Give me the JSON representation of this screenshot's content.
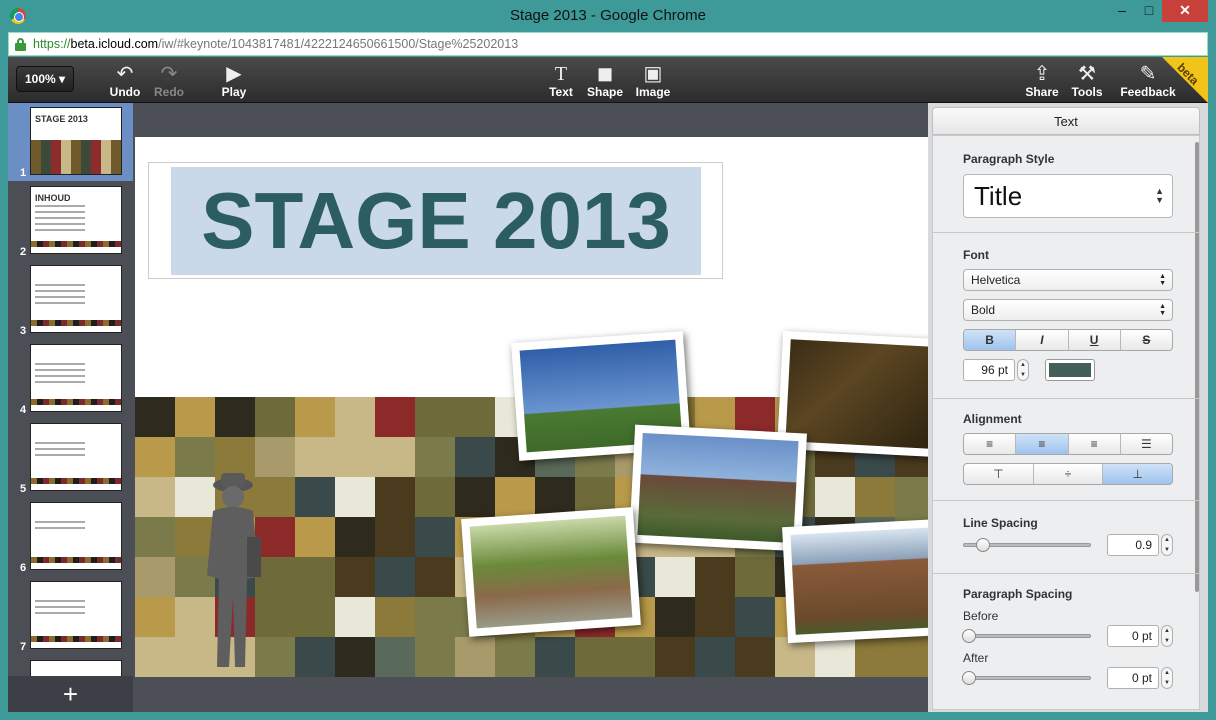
{
  "window": {
    "title": "Stage 2013 - Google Chrome",
    "minimize": "–",
    "maximize": "□",
    "close": "✕"
  },
  "address": {
    "scheme": "https://",
    "host": "beta.icloud.com",
    "path": "/iw/#keynote/1043817481/4222124650661500/Stage%25202013"
  },
  "toolbar": {
    "zoom": "100%",
    "undo": "Undo",
    "redo": "Redo",
    "play": "Play",
    "text": "Text",
    "shape": "Shape",
    "image": "Image",
    "share": "Share",
    "tools": "Tools",
    "feedback": "Feedback",
    "beta": "beta"
  },
  "slides": [
    {
      "num": "1",
      "title": "STAGE 2013"
    },
    {
      "num": "2",
      "title": "INHOUD"
    },
    {
      "num": "3",
      "title": ""
    },
    {
      "num": "4",
      "title": ""
    },
    {
      "num": "5",
      "title": ""
    },
    {
      "num": "6",
      "title": ""
    },
    {
      "num": "7",
      "title": ""
    }
  ],
  "slide": {
    "title": "STAGE 2013"
  },
  "inspector": {
    "tab": "Text",
    "paragraph_style_label": "Paragraph Style",
    "paragraph_style": "Title",
    "font_label": "Font",
    "font_family": "Helvetica",
    "font_weight": "Bold",
    "bold": "B",
    "italic": "I",
    "underline": "U",
    "strike": "S",
    "font_size": "96 pt",
    "text_color": "#435f57",
    "alignment_label": "Alignment",
    "line_spacing_label": "Line Spacing",
    "line_spacing": "0.9",
    "paragraph_spacing_label": "Paragraph Spacing",
    "before_label": "Before",
    "before": "0 pt",
    "after_label": "After",
    "after": "0 pt"
  },
  "colors": {
    "window": "#3e9a98",
    "title_text": "#2c5d63",
    "selection": "#c9d9ea"
  },
  "icons": [
    "chrome-icon",
    "lock-icon",
    "undo-icon",
    "redo-icon",
    "play-icon",
    "text-icon",
    "shape-icon",
    "image-icon",
    "share-icon",
    "wrench-icon",
    "feedback-icon",
    "plus-icon"
  ]
}
